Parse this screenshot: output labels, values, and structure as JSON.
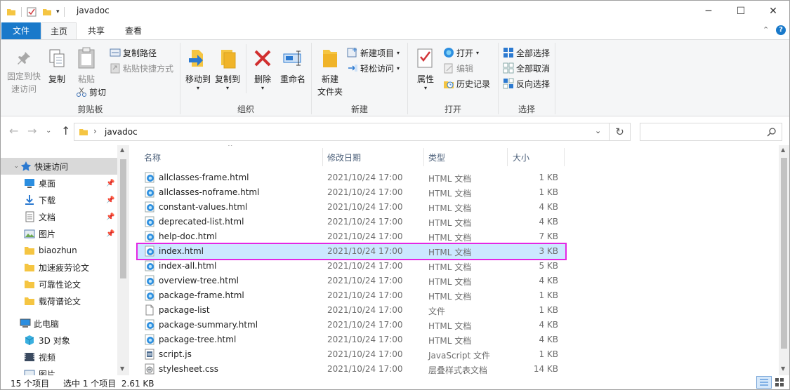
{
  "window": {
    "title": "javadoc",
    "controls": {
      "minimize": "─",
      "maximize": "☐",
      "close": "✕"
    }
  },
  "tabs": [
    {
      "label": "文件"
    },
    {
      "label": "主页"
    },
    {
      "label": "共享"
    },
    {
      "label": "查看"
    }
  ],
  "ribbon": {
    "clipboard": {
      "label": "剪贴板",
      "pin_line1": "固定到快",
      "pin_line2": "速访问",
      "copy": "复制",
      "paste": "粘贴",
      "copy_path": "复制路径",
      "paste_shortcut": "粘贴快捷方式",
      "cut": "剪切"
    },
    "organize": {
      "label": "组织",
      "move_to": "移动到",
      "copy_to": "复制到",
      "delete": "删除",
      "rename": "重命名"
    },
    "new": {
      "label": "新建",
      "new_folder_line1": "新建",
      "new_folder_line2": "文件夹",
      "new_item": "新建项目",
      "easy_access": "轻松访问"
    },
    "open": {
      "label": "打开",
      "properties": "属性",
      "open": "打开",
      "edit": "编辑",
      "history": "历史记录"
    },
    "select": {
      "label": "选择",
      "select_all": "全部选择",
      "select_none": "全部取消",
      "invert": "反向选择"
    }
  },
  "address": {
    "path": "javadoc",
    "search_placeholder": ""
  },
  "nav": {
    "quick_access": "快速访问",
    "pinned": [
      {
        "label": "桌面"
      },
      {
        "label": "下载"
      },
      {
        "label": "文档"
      },
      {
        "label": "图片"
      }
    ],
    "folders": [
      {
        "label": "biaozhun"
      },
      {
        "label": "加速疲劳论文"
      },
      {
        "label": "可靠性论文"
      },
      {
        "label": "载荷谱论文"
      }
    ],
    "this_pc": "此电脑",
    "pc_items": [
      {
        "label": "3D 对象"
      },
      {
        "label": "视频"
      },
      {
        "label": "图片"
      }
    ]
  },
  "columns": {
    "name": "名称",
    "date": "修改日期",
    "type": "类型",
    "size": "大小"
  },
  "files": [
    {
      "name": "allclasses-frame.html",
      "date": "2021/10/24 17:00",
      "type": "HTML 文档",
      "size": "1 KB",
      "icon": "html"
    },
    {
      "name": "allclasses-noframe.html",
      "date": "2021/10/24 17:00",
      "type": "HTML 文档",
      "size": "1 KB",
      "icon": "html"
    },
    {
      "name": "constant-values.html",
      "date": "2021/10/24 17:00",
      "type": "HTML 文档",
      "size": "4 KB",
      "icon": "html"
    },
    {
      "name": "deprecated-list.html",
      "date": "2021/10/24 17:00",
      "type": "HTML 文档",
      "size": "4 KB",
      "icon": "html"
    },
    {
      "name": "help-doc.html",
      "date": "2021/10/24 17:00",
      "type": "HTML 文档",
      "size": "7 KB",
      "icon": "html"
    },
    {
      "name": "index.html",
      "date": "2021/10/24 17:00",
      "type": "HTML 文档",
      "size": "3 KB",
      "icon": "html",
      "selected": true
    },
    {
      "name": "index-all.html",
      "date": "2021/10/24 17:00",
      "type": "HTML 文档",
      "size": "5 KB",
      "icon": "html"
    },
    {
      "name": "overview-tree.html",
      "date": "2021/10/24 17:00",
      "type": "HTML 文档",
      "size": "4 KB",
      "icon": "html"
    },
    {
      "name": "package-frame.html",
      "date": "2021/10/24 17:00",
      "type": "HTML 文档",
      "size": "1 KB",
      "icon": "html"
    },
    {
      "name": "package-list",
      "date": "2021/10/24 17:00",
      "type": "文件",
      "size": "1 KB",
      "icon": "file"
    },
    {
      "name": "package-summary.html",
      "date": "2021/10/24 17:00",
      "type": "HTML 文档",
      "size": "4 KB",
      "icon": "html"
    },
    {
      "name": "package-tree.html",
      "date": "2021/10/24 17:00",
      "type": "HTML 文档",
      "size": "4 KB",
      "icon": "html"
    },
    {
      "name": "script.js",
      "date": "2021/10/24 17:00",
      "type": "JavaScript 文件",
      "size": "1 KB",
      "icon": "js"
    },
    {
      "name": "stylesheet.css",
      "date": "2021/10/24 17:00",
      "type": "层叠样式表文档",
      "size": "14 KB",
      "icon": "css"
    }
  ],
  "status": {
    "count": "15 个项目",
    "selection": "选中 1 个项目  2.61 KB"
  },
  "colors": {
    "accent": "#1979ca",
    "selection": "#cce8ff",
    "highlight_border": "#e427e4",
    "folder": "#f5c542"
  }
}
